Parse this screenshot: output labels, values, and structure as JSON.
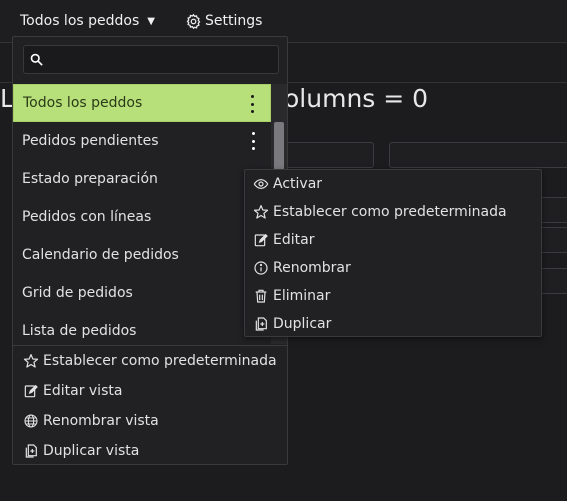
{
  "topbar": {
    "view_label": "Todos los peddos",
    "settings_label": "Settings"
  },
  "background": {
    "title_fragment_left": "L",
    "title_fragment_right": "olumns = 0"
  },
  "dropdown": {
    "search_placeholder": "",
    "views": [
      {
        "label": "Todos los peddos",
        "active": true
      },
      {
        "label": "Pedidos pendientes"
      },
      {
        "label": "Estado preparación"
      },
      {
        "label": "Pedidos con líneas"
      },
      {
        "label": "Calendario de pedidos"
      },
      {
        "label": "Grid de pedidos"
      },
      {
        "label": "Lista de pedidos"
      }
    ],
    "actions": [
      {
        "label": "Establecer como predeterminada",
        "icon": "star-icon"
      },
      {
        "label": "Editar vista",
        "icon": "edit-icon"
      },
      {
        "label": "Renombrar vista",
        "icon": "globe-icon"
      },
      {
        "label": "Duplicar vista",
        "icon": "duplicate-icon"
      }
    ]
  },
  "context_menu": {
    "items": [
      {
        "label": "Activar",
        "icon": "eye-icon"
      },
      {
        "label": "Establecer como predeterminada",
        "icon": "star-icon"
      },
      {
        "label": "Editar",
        "icon": "edit-icon"
      },
      {
        "label": "Renombrar",
        "icon": "info-icon"
      },
      {
        "label": "Eliminar",
        "icon": "trash-icon"
      },
      {
        "label": "Duplicar",
        "icon": "duplicate-icon"
      }
    ]
  },
  "colors": {
    "background": "#1c1c1e",
    "active_item": "#b8e07a",
    "menu_bg": "#212124"
  }
}
